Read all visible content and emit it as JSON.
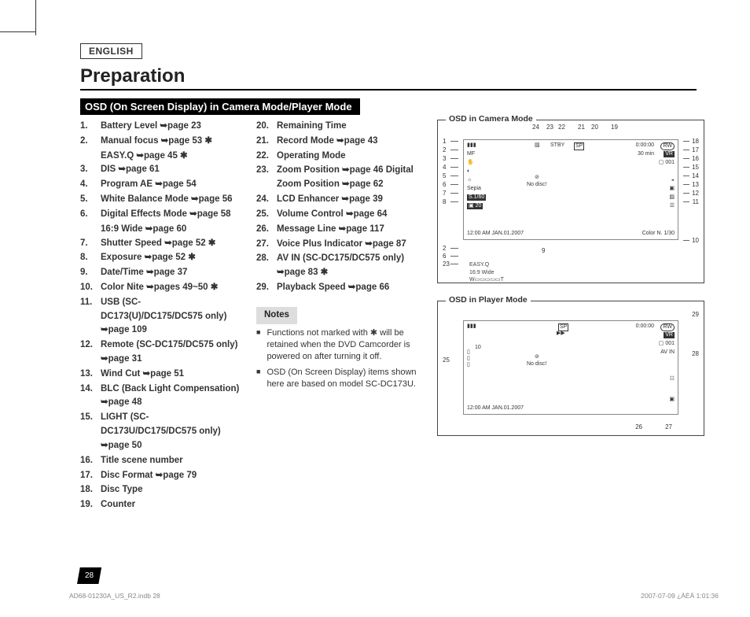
{
  "language_tab": "ENGLISH",
  "page_title": "Preparation",
  "section_heading": "OSD (On Screen Display) in Camera Mode/Player Mode",
  "col1": [
    {
      "n": "1.",
      "t": "Battery Level ➥page 23"
    },
    {
      "n": "2.",
      "t": "Manual focus ➥page 53 ✱",
      "sub": "EASY.Q ➥page 45 ✱"
    },
    {
      "n": "3.",
      "t": "DIS ➥page 61"
    },
    {
      "n": "4.",
      "t": "Program AE ➥page 54"
    },
    {
      "n": "5.",
      "t": "White Balance Mode ➥page 56"
    },
    {
      "n": "6.",
      "t": "Digital Effects Mode ➥page 58",
      "sub": "16:9 Wide ➥page 60"
    },
    {
      "n": "7.",
      "t": "Shutter Speed ➥page 52 ✱"
    },
    {
      "n": "8.",
      "t": "Exposure ➥page 52 ✱"
    },
    {
      "n": "9.",
      "t": "Date/Time ➥page 37"
    },
    {
      "n": "10.",
      "t": "Color Nite ➥pages 49~50 ✱"
    },
    {
      "n": "11.",
      "t": "USB (SC-DC173(U)/DC175/DC575 only) ➥page 109"
    },
    {
      "n": "12.",
      "t": "Remote (SC-DC175/DC575 only) ➥page 31"
    },
    {
      "n": "13.",
      "t": "Wind Cut ➥page 51"
    },
    {
      "n": "14.",
      "t": "BLC (Back Light Compensation) ➥page 48"
    },
    {
      "n": "15.",
      "t": "LIGHT (SC-DC173U/DC175/DC575 only) ➥page 50"
    },
    {
      "n": "16.",
      "t": "Title scene number"
    },
    {
      "n": "17.",
      "t": "Disc Format ➥page 79"
    },
    {
      "n": "18.",
      "t": "Disc Type"
    },
    {
      "n": "19.",
      "t": "Counter"
    }
  ],
  "col2": [
    {
      "n": "20.",
      "t": "Remaining Time"
    },
    {
      "n": "21.",
      "t": "Record Mode ➥page 43"
    },
    {
      "n": "22.",
      "t": "Operating Mode"
    },
    {
      "n": "23.",
      "t": "Zoom Position ➥page 46 Digital Zoom Position ➥page 62"
    },
    {
      "n": "24.",
      "t": "LCD Enhancer ➥page 39"
    },
    {
      "n": "25.",
      "t": "Volume Control ➥page 64"
    },
    {
      "n": "26.",
      "t": "Message Line ➥page 117"
    },
    {
      "n": "27.",
      "t": "Voice Plus Indicator ➥page 87"
    },
    {
      "n": "28.",
      "t": "AV IN (SC-DC175/DC575 only) ➥page 83 ✱"
    },
    {
      "n": "29.",
      "t": "Playback Speed ➥page 66"
    }
  ],
  "notes_heading": "Notes",
  "notes": [
    "Functions not marked with ✱ will be retained when the DVD Camcorder is powered on after turning it off.",
    "OSD (On Screen Display) items shown here are based on model SC-DC173U."
  ],
  "osd1": {
    "title": "OSD in Camera Mode",
    "top_nums": [
      "24",
      "23",
      "22",
      "21",
      "20",
      "19"
    ],
    "left_nums": [
      "1",
      "2",
      "3",
      "4",
      "5",
      "6",
      "7",
      "8",
      "2",
      "6",
      "23"
    ],
    "right_nums": [
      "18",
      "17",
      "16",
      "15",
      "14",
      "13",
      "12",
      "11",
      "10"
    ],
    "bottom_left_num": "9",
    "inner": {
      "stby": "STBY",
      "sp": "SP",
      "counter": "0:00:00",
      "rw": "RW",
      "remain": "30 min",
      "vr": "VR",
      "scene": "001",
      "nodisc": "No disc!",
      "sepia": "Sepia",
      "shutter": "S.1/60",
      "exposure": "20",
      "datetime": "12:00 AM JAN.01.2007",
      "colornite": "Color N. 1/30",
      "easyq": "EASY.Q",
      "wide": "16:9 Wide"
    }
  },
  "osd2": {
    "title": "OSD in Player Mode",
    "left_num": "25",
    "right_nums": [
      "29",
      "28",
      "27",
      "26"
    ],
    "inner": {
      "sp": "SP",
      "counter": "0:00:00",
      "rw": "RW",
      "vr": "VR",
      "scene": "001",
      "avin": "AV IN",
      "nodisc": "No disc!",
      "plus": "▶▶",
      "vol": "10",
      "datetime": "12:00 AM JAN.01.2007"
    }
  },
  "page_number": "28",
  "footer_left": "AD68-01230A_US_R2.indb   28",
  "footer_right": "2007-07-09   ¿ÀÈÄ 1:01:36"
}
